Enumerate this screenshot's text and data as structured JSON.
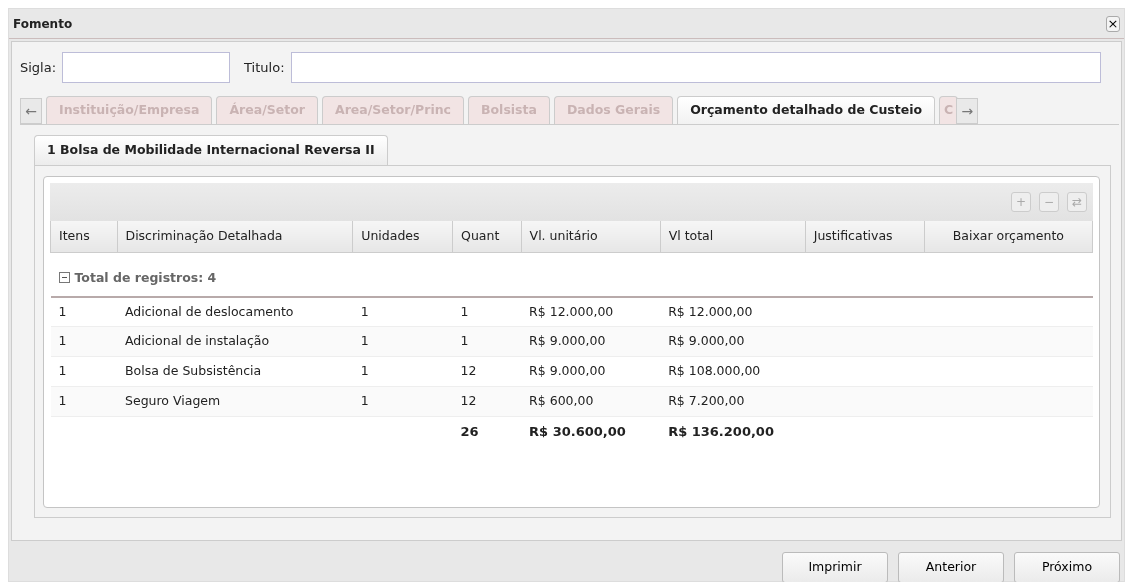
{
  "window": {
    "title": "Fomento",
    "close": "×"
  },
  "fields": [
    {
      "label": "Sigla:"
    },
    {
      "label": "Titulo:"
    }
  ],
  "tab_scroll": {
    "left": "←",
    "right": "→"
  },
  "tabs": [
    {
      "label": "Instituição/Empresa",
      "selected": false,
      "disabled": true
    },
    {
      "label": "Área/Setor",
      "selected": false,
      "disabled": true
    },
    {
      "label": "Area/Setor/Princ",
      "selected": false,
      "disabled": true
    },
    {
      "label": "Bolsista",
      "selected": false,
      "disabled": true
    },
    {
      "label": "Dados Gerais",
      "selected": false,
      "disabled": true
    },
    {
      "label": "Orçamento detalhado de Custeio",
      "selected": true,
      "disabled": false
    },
    {
      "label": "C",
      "selected": false,
      "disabled": true
    }
  ],
  "subtabs": [
    {
      "label": "1 Bolsa de Mobilidade Internacional Reversa II",
      "selected": true
    }
  ],
  "toolbar": [
    "+",
    "−",
    "⇄"
  ],
  "table": {
    "columns": [
      "Itens",
      "Discriminação Detalhada",
      "Unidades",
      "Quant",
      "Vl. unitário",
      "Vl total",
      "Justificativas",
      "Baixar orçamento"
    ],
    "group": {
      "label": "Total de registros: 4",
      "expanded": true
    },
    "rows": [
      [
        "1",
        "Adicional de deslocamento",
        "1",
        "1",
        "R$ 12.000,00",
        "R$ 12.000,00"
      ],
      [
        "1",
        "Adicional de instalação",
        "1",
        "1",
        "R$ 9.000,00",
        "R$ 9.000,00"
      ],
      [
        "1",
        "Bolsa de Subsistência",
        "1",
        "12",
        "R$ 9.000,00",
        "R$ 108.000,00"
      ],
      [
        "1",
        "Seguro Viagem",
        "1",
        "12",
        "R$ 600,00",
        "R$ 7.200,00"
      ]
    ],
    "totals": {
      "quant": "26",
      "unit_value": "R$ 30.600,00",
      "total_value": "R$ 136.200,00"
    }
  },
  "buttons": [
    "Imprimir",
    "Anterior",
    "Próximo"
  ]
}
